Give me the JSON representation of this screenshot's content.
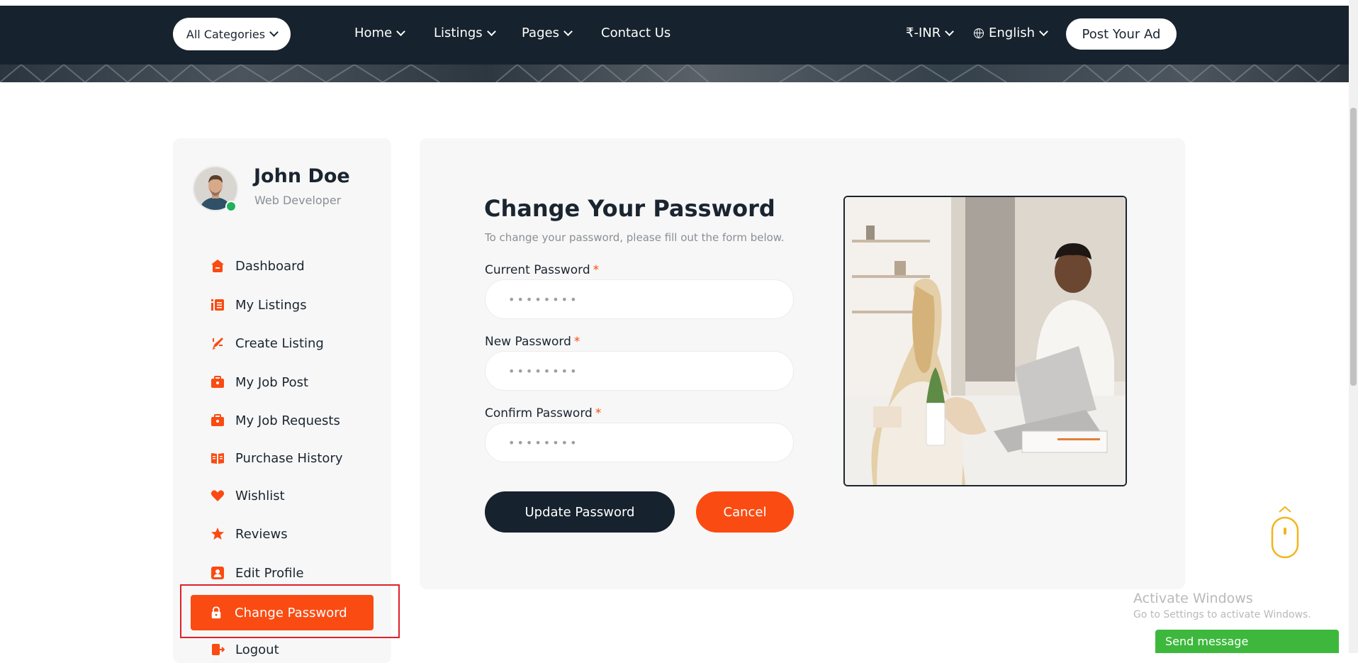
{
  "header": {
    "categories_label": "All Categories",
    "nav": [
      {
        "label": "Home"
      },
      {
        "label": "Listings"
      },
      {
        "label": "Pages"
      },
      {
        "label": "Contact Us"
      }
    ],
    "currency": "₹-INR",
    "language": "English",
    "post_ad_label": "Post Your Ad"
  },
  "profile": {
    "name": "John Doe",
    "role": "Web Developer",
    "status": "online"
  },
  "sidebar": {
    "items": [
      {
        "label": "Dashboard",
        "icon": "home-icon"
      },
      {
        "label": "My Listings",
        "icon": "list-icon"
      },
      {
        "label": "Create Listing",
        "icon": "megaphone-icon"
      },
      {
        "label": "My Job Post",
        "icon": "briefcase-icon"
      },
      {
        "label": "My Job Requests",
        "icon": "briefcase-icon"
      },
      {
        "label": "Purchase History",
        "icon": "book-icon"
      },
      {
        "label": "Wishlist",
        "icon": "heart-icon"
      },
      {
        "label": "Reviews",
        "icon": "star-icon"
      },
      {
        "label": "Edit Profile",
        "icon": "user-card-icon"
      },
      {
        "label": "Change Password",
        "icon": "lock-icon",
        "active": true
      },
      {
        "label": "Logout",
        "icon": "logout-icon"
      }
    ]
  },
  "form": {
    "title": "Change Your Password",
    "subtitle": "To change your password, please fill out the form below.",
    "required_mark": "*",
    "fields": [
      {
        "label": "Current Password",
        "value": "••••••••"
      },
      {
        "label": "New Password",
        "value": "••••••••"
      },
      {
        "label": "Confirm Password",
        "value": "••••••••"
      }
    ],
    "update_label": "Update Password",
    "cancel_label": "Cancel"
  },
  "overlay": {
    "activate_title": "Activate Windows",
    "activate_sub": "Go to Settings to activate Windows.",
    "send_message": "Send message"
  },
  "colors": {
    "accent": "#fa4b12",
    "dark": "#16222d",
    "card_bg": "#f7f7f7",
    "online": "#20b15a",
    "chat_green": "#3db83d",
    "scroll_icon": "#f2b51d"
  }
}
